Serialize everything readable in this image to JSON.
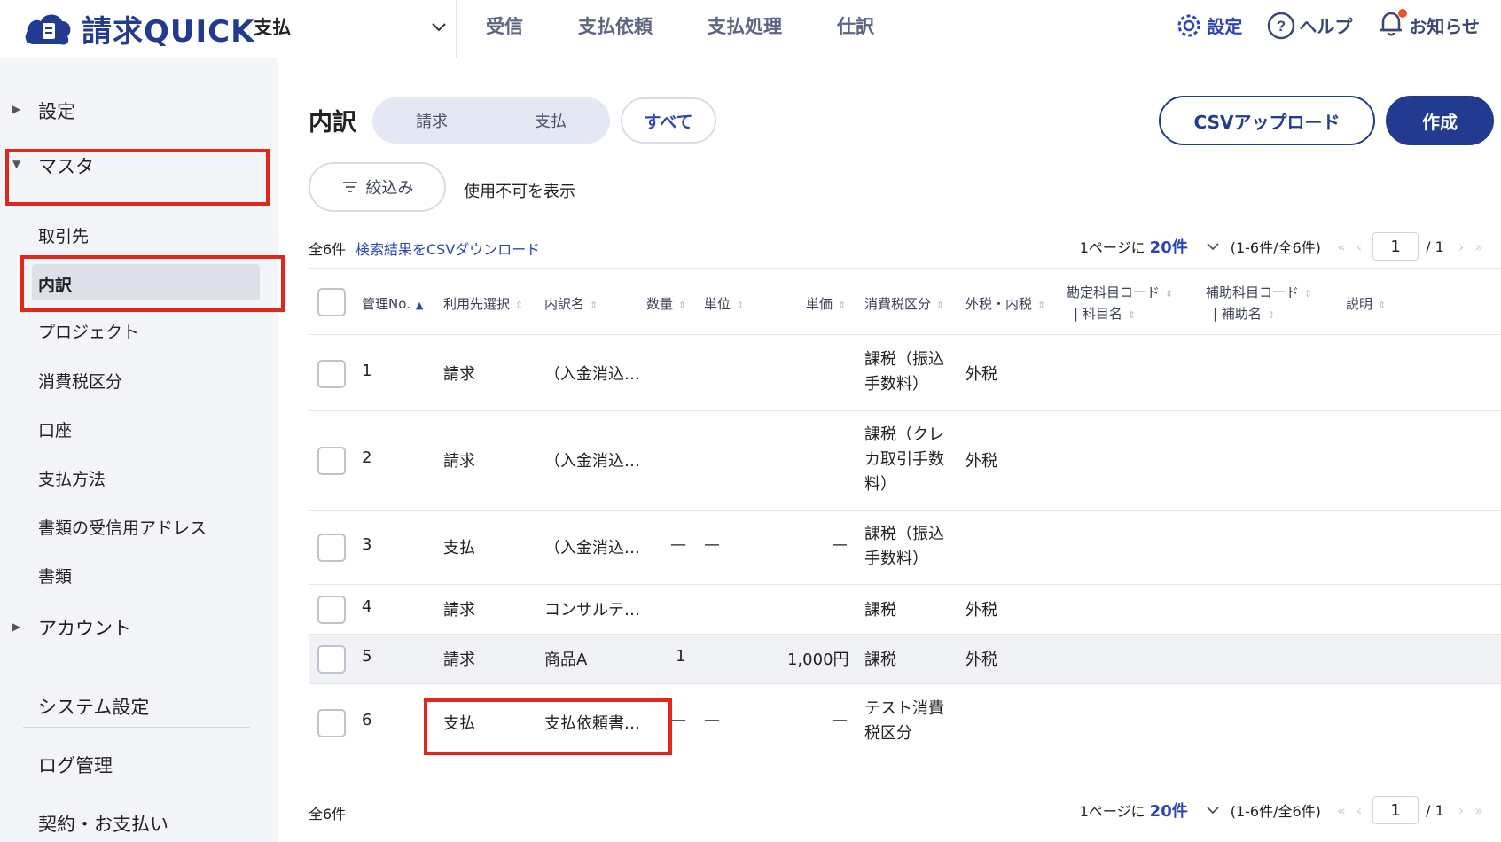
{
  "header": {
    "logo_text": "請求QUICK",
    "product_select": "支払",
    "nav": [
      "受信",
      "支払依頼",
      "支払処理",
      "仕訳"
    ],
    "settings": "設定",
    "help": "ヘルプ",
    "notifications": "お知らせ"
  },
  "sidebar": {
    "settings": "設定",
    "master": "マスタ",
    "sub_items": [
      "取引先",
      "内訳",
      "プロジェクト",
      "消費税区分",
      "口座",
      "支払方法",
      "書類の受信用アドレス",
      "書類"
    ],
    "account": "アカウント",
    "system_settings": "システム設定",
    "log_management": "ログ管理",
    "contract_payment": "契約・お支払い"
  },
  "main": {
    "title": "内訳",
    "segment": [
      "請求",
      "支払"
    ],
    "all_label": "すべて",
    "csv_upload": "CSVアップロード",
    "create": "作成",
    "filter": "絞込み",
    "show_disabled": "使用不可を表示",
    "total_count": "全6件",
    "csv_download": "検索結果をCSVダウンロード",
    "pager": {
      "per_page_prefix": "1ページに",
      "per_page_value": "20件",
      "range": "(1-6件/全6件)",
      "page": "1",
      "of": "/ 1"
    },
    "columns": {
      "no": "管理No.",
      "usage": "利用先選択",
      "name": "内訳名",
      "qty": "数量",
      "unit": "単位",
      "price": "単価",
      "tax": "消費税区分",
      "taxtype": "外税・内税",
      "acct": "勘定科目コード",
      "acct_sub": "| 科目名",
      "subacct": "補助科目コード",
      "subacct_sub": "| 補助名",
      "desc": "説明"
    },
    "rows": [
      {
        "no": "1",
        "usage": "請求",
        "name": "（入金消込…",
        "qty": "",
        "unit": "",
        "price": "",
        "tax": "課税（振込手数料）",
        "taxtype": "外税"
      },
      {
        "no": "2",
        "usage": "請求",
        "name": "（入金消込…",
        "qty": "",
        "unit": "",
        "price": "",
        "tax": "課税（クレカ取引手数料）",
        "taxtype": "外税"
      },
      {
        "no": "3",
        "usage": "支払",
        "name": "（入金消込…",
        "qty": "—",
        "unit": "—",
        "price": "—",
        "tax": "課税（振込手数料）",
        "taxtype": ""
      },
      {
        "no": "4",
        "usage": "請求",
        "name": "コンサルテ…",
        "qty": "",
        "unit": "",
        "price": "",
        "tax": "課税",
        "taxtype": "外税"
      },
      {
        "no": "5",
        "usage": "請求",
        "name": "商品A",
        "qty": "1",
        "unit": "",
        "price": "1,000円",
        "tax": "課税",
        "taxtype": "外税"
      },
      {
        "no": "6",
        "usage": "支払",
        "name": "支払依頼書…",
        "qty": "—",
        "unit": "—",
        "price": "—",
        "tax": "テスト消費税区分",
        "taxtype": ""
      }
    ],
    "footer_count": "全6件"
  },
  "colors": {
    "brand": "#223a8f",
    "accent": "#2d45b4",
    "highlight_box": "#e1261c"
  }
}
